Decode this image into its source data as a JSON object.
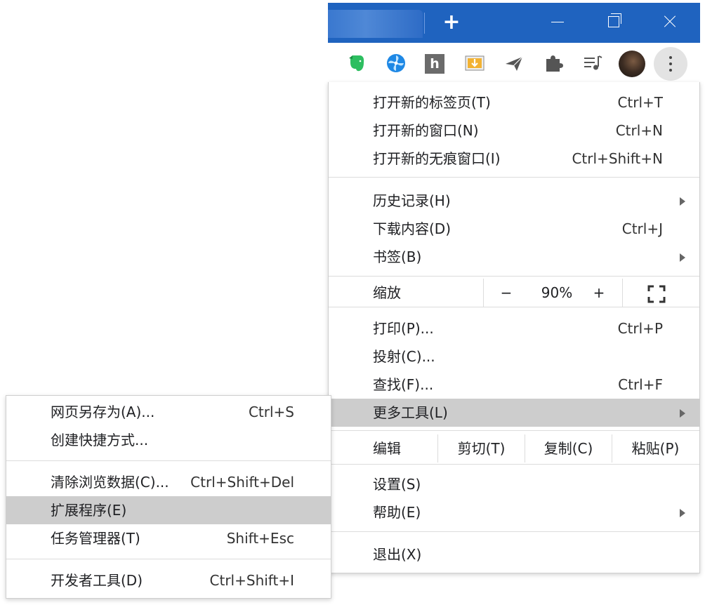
{
  "window": {
    "new_tab": "+",
    "controls": [
      "minimize",
      "restore",
      "close"
    ]
  },
  "toolbar": {
    "extensions": [
      "evernote-icon",
      "fan-icon",
      "h-extension-icon",
      "image-download-icon",
      "send-icon",
      "puzzle-icon",
      "media-control-icon",
      "profile-avatar",
      "menu-icon"
    ],
    "h_label": "h"
  },
  "menu": {
    "new_tab": {
      "label": "打开新的标签页(T)",
      "shortcut": "Ctrl+T"
    },
    "new_window": {
      "label": "打开新的窗口(N)",
      "shortcut": "Ctrl+N"
    },
    "new_incognito": {
      "label": "打开新的无痕窗口(I)",
      "shortcut": "Ctrl+Shift+N"
    },
    "history": {
      "label": "历史记录(H)"
    },
    "downloads": {
      "label": "下载内容(D)",
      "shortcut": "Ctrl+J"
    },
    "bookmarks": {
      "label": "书签(B)"
    },
    "zoom": {
      "label": "缩放",
      "minus": "−",
      "value": "90%",
      "plus": "+"
    },
    "print": {
      "label": "打印(P)...",
      "shortcut": "Ctrl+P"
    },
    "cast": {
      "label": "投射(C)..."
    },
    "find": {
      "label": "查找(F)...",
      "shortcut": "Ctrl+F"
    },
    "more_tools": {
      "label": "更多工具(L)"
    },
    "edit": {
      "label": "编辑",
      "cut": "剪切(T)",
      "copy": "复制(C)",
      "paste": "粘贴(P)"
    },
    "settings": {
      "label": "设置(S)"
    },
    "help": {
      "label": "帮助(E)"
    },
    "exit": {
      "label": "退出(X)"
    }
  },
  "submenu": {
    "save_page": {
      "label": "网页另存为(A)...",
      "shortcut": "Ctrl+S"
    },
    "create_shortcut": {
      "label": "创建快捷方式..."
    },
    "clear_data": {
      "label": "清除浏览数据(C)...",
      "shortcut": "Ctrl+Shift+Del"
    },
    "extensions": {
      "label": "扩展程序(E)"
    },
    "task_manager": {
      "label": "任务管理器(T)",
      "shortcut": "Shift+Esc"
    },
    "dev_tools": {
      "label": "开发者工具(D)",
      "shortcut": "Ctrl+Shift+I"
    }
  },
  "colors": {
    "titlebar": "#1f63bf",
    "highlight": "#cdcdcd",
    "separator": "#dcdcdc"
  }
}
